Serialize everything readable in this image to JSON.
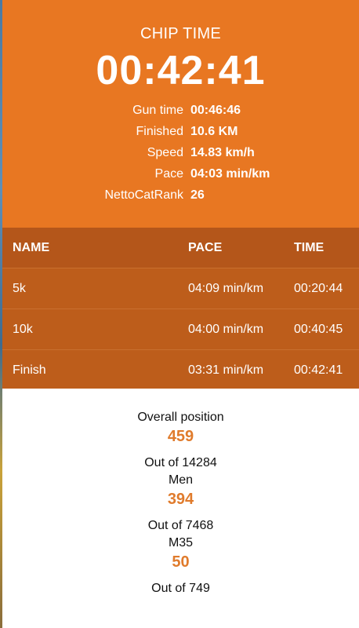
{
  "header": {
    "chip_label": "CHIP TIME",
    "chip_time": "00:42:41",
    "stats": [
      {
        "label": "Gun time",
        "value": "00:46:46"
      },
      {
        "label": "Finished",
        "value": "10.6 KM"
      },
      {
        "label": "Speed",
        "value": "14.83 km/h"
      },
      {
        "label": "Pace",
        "value": "04:03 min/km"
      },
      {
        "label": "NettoCatRank",
        "value": "26"
      }
    ]
  },
  "splits": {
    "headers": {
      "name": "NAME",
      "pace": "PACE",
      "time": "TIME"
    },
    "rows": [
      {
        "name": "5k",
        "pace": "04:09 min/km",
        "time": "00:20:44"
      },
      {
        "name": "10k",
        "pace": "04:00 min/km",
        "time": "00:40:45"
      },
      {
        "name": "Finish",
        "pace": "03:31 min/km",
        "time": "00:42:41"
      }
    ]
  },
  "positions": [
    {
      "label": "Overall position",
      "value": "459",
      "total": "Out of 14284"
    },
    {
      "label": "Men",
      "value": "394",
      "total": "Out of 7468"
    },
    {
      "label": "M35",
      "value": "50",
      "total": "Out of 749"
    }
  ],
  "colors": {
    "header_bg": "#e87722",
    "table_bg": "#bd5d1b",
    "accent_value": "#e07b2c"
  }
}
